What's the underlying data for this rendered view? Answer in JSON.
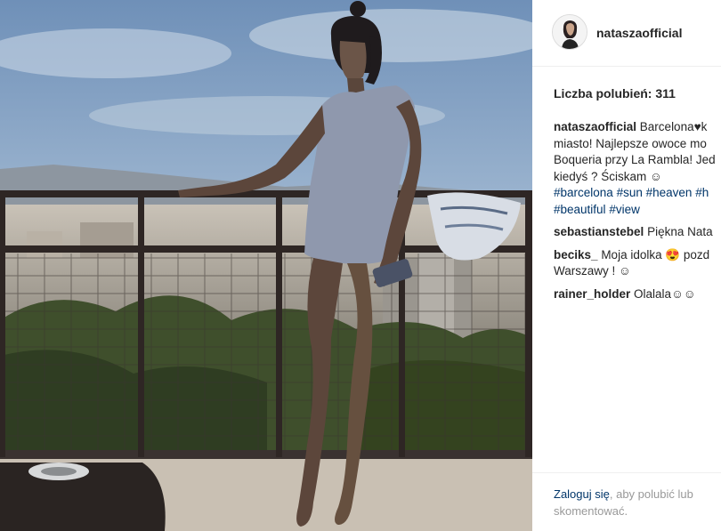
{
  "post": {
    "username": "nataszaofficial",
    "likes_text": "Liczba polubień: 311",
    "caption": {
      "user": "nataszaofficial",
      "line1": "Barcelona",
      "heart": "♥",
      "line1b": "k",
      "line2": "miasto! Najlepsze owoce mo",
      "line3": "Boqueria przy La Rambla! Jed",
      "line4": "kiedyś ? Ściskam ☺",
      "tags_line1": [
        "#barcelona",
        "#sun",
        "#heaven",
        "#h"
      ],
      "tags_line2": [
        "#beautiful",
        "#view"
      ]
    },
    "comments": [
      {
        "user": "sebastianstebel",
        "text": "Piękna Nata"
      },
      {
        "user": "beciks_",
        "text": "Moja idolka 😍 pozd",
        "text2": "Warszawy ! ☺"
      },
      {
        "user": "rainer_holder",
        "text": "Olalala☺☺"
      }
    ],
    "login": {
      "link": "Zaloguj się",
      "rest": ", aby polubić lub skomentować."
    }
  },
  "colors": {
    "link": "#003569",
    "text": "#262626",
    "muted": "#999999",
    "sky": "#7d9cc0"
  },
  "icons": [
    "avatar"
  ]
}
